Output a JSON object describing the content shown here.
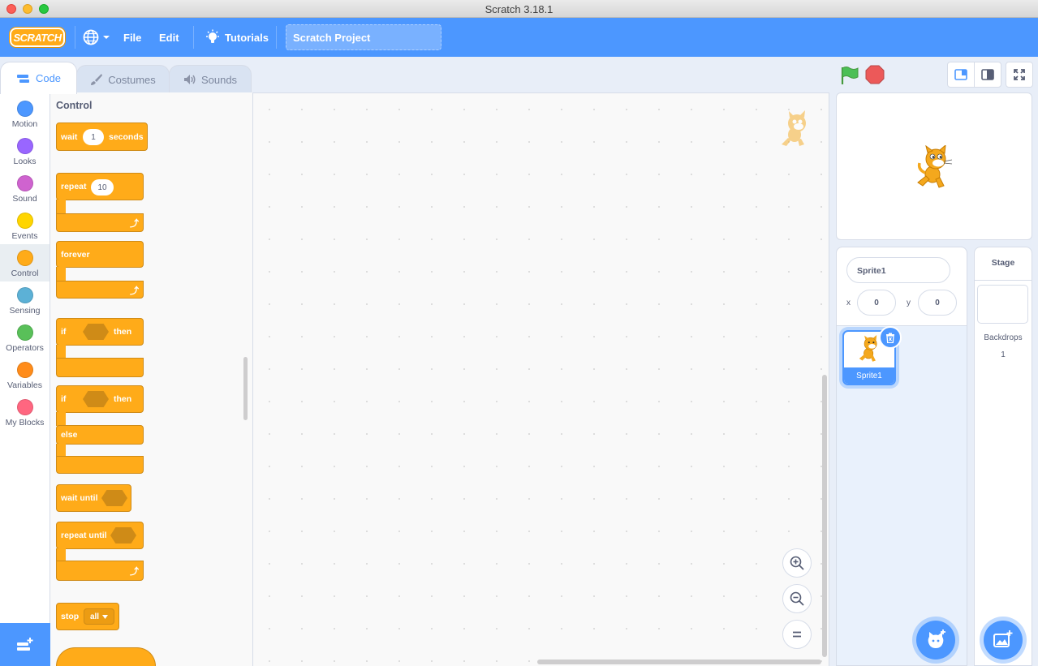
{
  "window": {
    "title": "Scratch 3.18.1"
  },
  "menubar": {
    "logo_text": "SCRATCH",
    "file_label": "File",
    "edit_label": "Edit",
    "tutorials_label": "Tutorials",
    "project_title": "Scratch Project"
  },
  "tabs": [
    {
      "label": "Code",
      "active": true
    },
    {
      "label": "Costumes",
      "active": false
    },
    {
      "label": "Sounds",
      "active": false
    }
  ],
  "categories": [
    {
      "label": "Motion",
      "color": "#4c97ff"
    },
    {
      "label": "Looks",
      "color": "#9966ff"
    },
    {
      "label": "Sound",
      "color": "#cf63cf"
    },
    {
      "label": "Events",
      "color": "#ffd500"
    },
    {
      "label": "Control",
      "color": "#ffab19",
      "selected": true
    },
    {
      "label": "Sensing",
      "color": "#5cb1d6"
    },
    {
      "label": "Operators",
      "color": "#59c059"
    },
    {
      "label": "Variables",
      "color": "#ff8c1a"
    },
    {
      "label": "My Blocks",
      "color": "#ff6680"
    }
  ],
  "palette": {
    "heading": "Control",
    "blocks": {
      "wait": {
        "label": "wait",
        "value": "1",
        "suffix": "seconds"
      },
      "repeat": {
        "label": "repeat",
        "value": "10"
      },
      "forever": {
        "label": "forever"
      },
      "if_then": {
        "if": "if",
        "then": "then"
      },
      "if_else": {
        "if": "if",
        "then": "then",
        "else": "else"
      },
      "wait_until": {
        "label": "wait until"
      },
      "repeat_until": {
        "label": "repeat until"
      },
      "stop": {
        "label": "stop",
        "value": "all"
      }
    },
    "block_color": "#ffab19"
  },
  "sprite_info": {
    "name": "Sprite1",
    "x_label": "x",
    "x_value": "0",
    "y_label": "y",
    "y_value": "0"
  },
  "sprite_list": [
    {
      "name": "Sprite1",
      "selected": true
    }
  ],
  "stage_pane": {
    "header": "Stage",
    "backdrops_label": "Backdrops",
    "backdrops_count": "1"
  },
  "colors": {
    "accent": "#4c97ff",
    "control": "#ffab19",
    "flag": "#4cbf56",
    "stop": "#ec5959"
  },
  "icons": {
    "language": "globe-icon",
    "tutorials": "lightbulb-icon",
    "green_flag": "green-flag-icon",
    "stop": "stop-icon",
    "zoom_in": "zoom-in-icon",
    "zoom_out": "zoom-out-icon",
    "zoom_reset": "zoom-reset-icon"
  }
}
